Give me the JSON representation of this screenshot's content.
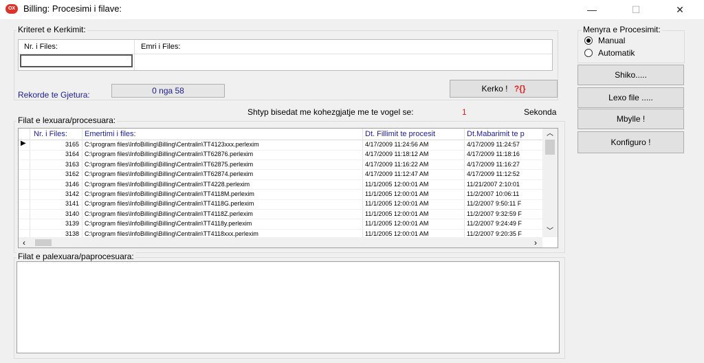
{
  "window": {
    "title": "Billing: Procesimi i filave:",
    "app_icon": "OX",
    "minimize": "—",
    "maximize": "☐",
    "close": "✕"
  },
  "search": {
    "legend": "Kriteret e Kerkimit:",
    "col_file_nr": "Nr. i Files:",
    "col_file_name": "Emri i Files:",
    "file_nr_value": "",
    "file_name_value": "",
    "records_label": "Rekorde te Gjetura:",
    "records_value": "0 nga  58",
    "search_button": "Kerko !",
    "search_icon_glyph": "?{}"
  },
  "mode": {
    "legend": "Menyra e Procesimit:",
    "manual": "Manual",
    "automatic": "Automatik",
    "selected": "Manual"
  },
  "side_buttons": {
    "view": "Shiko.....",
    "read": "Lexo file .....",
    "close": "Mbylle !",
    "configure": "Konfiguro !"
  },
  "hint": {
    "text": "Shtyp bisedat me kohezgjatje me te vogel se:",
    "value": "1",
    "unit": "Sekonda"
  },
  "processed": {
    "legend": "Filat e lexuara/procesuara:",
    "columns": [
      "Nr. i Files:",
      "Emertimi i files:",
      "Dt. Fillimit te procesit",
      "Dt.Mabarimit te p"
    ],
    "rows": [
      {
        "nr": "3165",
        "name": "C:\\program files\\InfoBilling\\Billing\\Centralin\\TT4123xxx.perlexim",
        "start": "4/17/2009 11:24:56 AM",
        "end": "4/17/2009 11:24:57"
      },
      {
        "nr": "3164",
        "name": "C:\\program files\\InfoBilling\\Billing\\Centralin\\TT62876.perlexim",
        "start": "4/17/2009 11:18:12 AM",
        "end": "4/17/2009 11:18:16"
      },
      {
        "nr": "3163",
        "name": "C:\\program files\\InfoBilling\\Billing\\Centralin\\TT62875.perlexim",
        "start": "4/17/2009 11:16:22 AM",
        "end": "4/17/2009 11:16:27"
      },
      {
        "nr": "3162",
        "name": "C:\\program files\\InfoBilling\\Billing\\Centralin\\TT62874.perlexim",
        "start": "4/17/2009 11:12:47 AM",
        "end": "4/17/2009 11:12:52"
      },
      {
        "nr": "3146",
        "name": "C:\\program files\\InfoBilling\\Billing\\Centralin\\TT4228.perlexim",
        "start": "11/1/2005 12:00:01 AM",
        "end": "11/21/2007 2:10:01"
      },
      {
        "nr": "3142",
        "name": "C:\\program files\\InfoBilling\\Billing\\Centralin\\TT4118M.perlexim",
        "start": "11/1/2005 12:00:01 AM",
        "end": "11/2/2007 10:06:11"
      },
      {
        "nr": "3141",
        "name": "C:\\program files\\InfoBilling\\Billing\\Centralin\\TT4118G.perlexim",
        "start": "11/1/2005 12:00:01 AM",
        "end": "11/2/2007 9:50:11 F"
      },
      {
        "nr": "3140",
        "name": "C:\\program files\\InfoBilling\\Billing\\Centralin\\TT4118Z.perlexim",
        "start": "11/1/2005 12:00:01 AM",
        "end": "11/2/2007 9:32:59 F"
      },
      {
        "nr": "3139",
        "name": "C:\\program files\\InfoBilling\\Billing\\Centralin\\TT4118y.perlexim",
        "start": "11/1/2005 12:00:01 AM",
        "end": "11/2/2007 9:24:49 F"
      },
      {
        "nr": "3138",
        "name": "C:\\program files\\InfoBilling\\Billing\\Centralin\\TT4118xxx.perlexim",
        "start": "11/1/2005 12:00:01 AM",
        "end": "11/2/2007 9:20:35 F"
      }
    ],
    "current_row_glyph": "▶"
  },
  "unprocessed": {
    "legend": "Filat e palexuara/paprocesuara:"
  },
  "colors": {
    "link_blue": "#1c1c8a",
    "accent_red": "#e02020"
  }
}
